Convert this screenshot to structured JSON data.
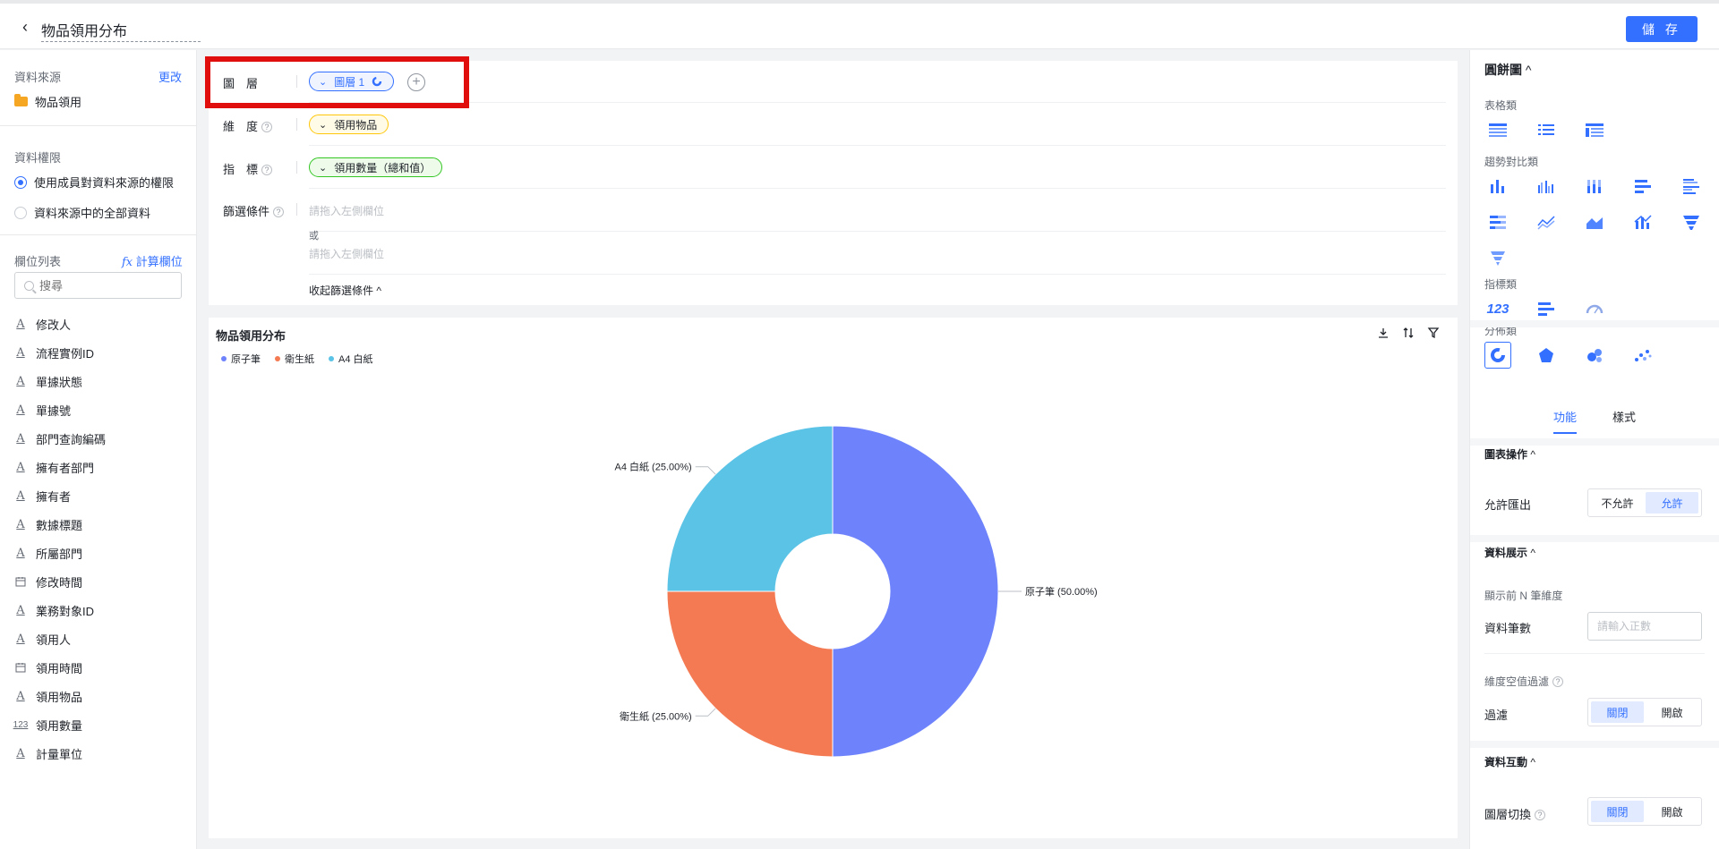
{
  "header": {
    "back_glyph": "‹",
    "title": "物品領用分布",
    "save_label": "儲 存"
  },
  "left": {
    "datasource_label": "資料來源",
    "change_link": "更改",
    "datasource_name": "物品領用",
    "permission_label": "資料權限",
    "permission_options": [
      "使用成員對資料來源的權限",
      "資料來源中的全部資料"
    ],
    "fields_label": "欄位列表",
    "calc_link": "計算欄位",
    "search_placeholder": "搜尋",
    "fields": [
      {
        "icon": "A",
        "label": "修改人"
      },
      {
        "icon": "A",
        "label": "流程實例ID"
      },
      {
        "icon": "A",
        "label": "單據狀態"
      },
      {
        "icon": "A",
        "label": "單據號"
      },
      {
        "icon": "A",
        "label": "部門查詢編碼"
      },
      {
        "icon": "A",
        "label": "擁有者部門"
      },
      {
        "icon": "A",
        "label": "擁有者"
      },
      {
        "icon": "A",
        "label": "數據標題"
      },
      {
        "icon": "A",
        "label": "所屬部門"
      },
      {
        "icon": "calendar",
        "label": "修改時間"
      },
      {
        "icon": "A",
        "label": "業務對象ID"
      },
      {
        "icon": "A",
        "label": "領用人"
      },
      {
        "icon": "calendar",
        "label": "領用時間"
      },
      {
        "icon": "A",
        "label": "領用物品"
      },
      {
        "icon": "123",
        "label": "領用數量"
      },
      {
        "icon": "A",
        "label": "計量單位"
      }
    ]
  },
  "config": {
    "layer_label": "圖　層",
    "layer_pill": "圖層 1",
    "dimension_label": "維　度",
    "dimension_pill": "領用物品",
    "metric_label": "指　標",
    "metric_pill": "領用數量（總和值）",
    "filter_label": "篩選條件",
    "filter_placeholder": "請拖入左側欄位",
    "or_label": "或",
    "collapse_label": "收起篩選條件 ^"
  },
  "chart_data": {
    "type": "pie",
    "title": "物品領用分布",
    "donut": true,
    "categories": [
      "原子筆",
      "衛生紙",
      "A4 白紙"
    ],
    "values": [
      50,
      25,
      25
    ],
    "labels": [
      "原子筆 (50.00%)",
      "衛生紙 (25.00%)",
      "A4 白紙 (25.00%)"
    ],
    "colors": [
      "#6e83fb",
      "#f47a53",
      "#5bc3e6"
    ],
    "legend_position": "top-left"
  },
  "right": {
    "chart_type_title": "圓餅圖",
    "groups": [
      "表格類",
      "趨勢對比類",
      "指標類",
      "分佈類"
    ],
    "metric_icon_text": "123",
    "tabs": [
      "功能",
      "樣式"
    ],
    "chart_ops_title": "圖表操作",
    "allow_export_label": "允許匯出",
    "export_options": [
      "不允許",
      "允許"
    ],
    "display_title": "資料展示",
    "top_n_label": "顯示前 N 筆維度",
    "count_label": "資料筆數",
    "count_placeholder": "請輸入正數",
    "null_filter_label": "維度空值過濾",
    "filter_label": "過濾",
    "filter_options": [
      "關閉",
      "開啟"
    ],
    "interact_title": "資料互動",
    "layer_switch_label": "圖層切換",
    "layer_switch_options": [
      "關閉",
      "開啟"
    ]
  }
}
